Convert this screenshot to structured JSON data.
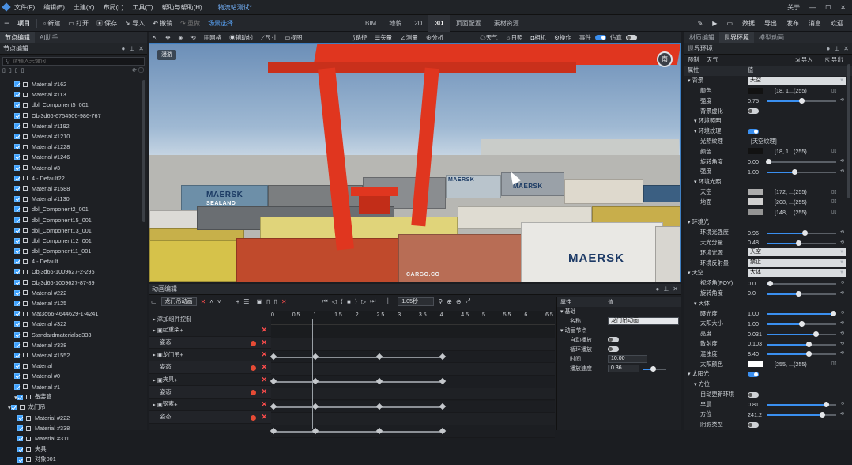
{
  "titlebar": {
    "menu": [
      "文件(F)",
      "编辑(E)",
      "土建(Y)",
      "布局(L)",
      "工具(T)",
      "帮助与帮助(H)"
    ],
    "doc_title": "物流站测试*",
    "right": [
      "关于"
    ]
  },
  "toolbar": {
    "project": "项目",
    "items": [
      "新建",
      "打开",
      "保存",
      "导入",
      "撤销",
      "重做",
      "场景选择"
    ],
    "mid_tabs": [
      "BIM",
      "地貌",
      "2D",
      "3D",
      "页面配置",
      "素材资源"
    ],
    "active_tab": "3D",
    "right_items": [
      "数据",
      "导出",
      "发布",
      "消息",
      "欢迎"
    ]
  },
  "left": {
    "tabs": [
      "节点编辑",
      "AI助手"
    ],
    "section": "节点编辑",
    "search_placeholder": "请输入关键词",
    "tree": [
      "Material #162",
      "Material #113",
      "dbl_Component5_001",
      "Obj3d66-6754506-986-767",
      "Material #1192",
      "Material #1210",
      "Material #1228",
      "Material #1246",
      "Material #3",
      "4 - Default22",
      "Material #1588",
      "Material #1130",
      "dbl_Component2_001",
      "dbl_Component15_001",
      "dbl_Component13_001",
      "dbl_Component12_001",
      "dbl_Component11_001",
      "4 - Default",
      "Obj3d66-1009627-2-295",
      "Obj3d66-1009627-87-89",
      "Material #222",
      "Material #125",
      "Mat3d66-4644629-1-4241",
      "Material #322",
      "Standardmaterialsd333",
      "Material #338",
      "Material #1552",
      "Material",
      "Material #0",
      "Material #1",
      "备装管",
      "龙门吊",
      "Material #222",
      "Material #338",
      "Material #311",
      "夹具",
      "对象001"
    ]
  },
  "viewport": {
    "toolbar": [
      "网格",
      "辅助线",
      "尺寸",
      "视图",
      "路径",
      "矢量",
      "测量",
      "分析",
      "天气",
      "日照",
      "相机",
      "操作",
      "事件",
      "仿真"
    ],
    "mode_button": "漫游",
    "compass": "南",
    "labels": {
      "maersk": "MAERSK",
      "sealand": "SEALAND",
      "cargo": "CARGO.CO"
    }
  },
  "animation": {
    "title": "动画编辑",
    "selected": "龙门吊动画",
    "time": "1.05秒",
    "add_label": "添加组件控制",
    "tracks": [
      {
        "name": "起重架",
        "sub": "姿态"
      },
      {
        "name": "龙门吊",
        "sub": "姿态"
      },
      {
        "name": "夹具",
        "sub": "姿态"
      },
      {
        "name": "钢索",
        "sub": "姿态"
      }
    ],
    "ruler": [
      "0",
      "0.5",
      "1",
      "1.5",
      "2",
      "2.5",
      "3",
      "3.5",
      "4",
      "4.5",
      "5",
      "5.5",
      "6",
      "6.5"
    ],
    "props": {
      "header_a": "属性",
      "header_b": "值",
      "basic": "基础",
      "name_label": "名称",
      "name_value": "龙门吊动画",
      "anim_node": "动画节点",
      "autoplay": "自动播放",
      "loop": "循环播放",
      "time_label": "时间",
      "time_value": "10.00",
      "speed_label": "播放速度",
      "speed_value": "0.36"
    }
  },
  "right": {
    "tabs": [
      "材质编辑",
      "世界环境",
      "模型动画"
    ],
    "active_tab": "世界环境",
    "section": "世界环境",
    "preset": "预制",
    "preset_value": "天气",
    "import": "导入",
    "export": "导出",
    "col_a": "属性",
    "col_b": "值",
    "rows": [
      {
        "label": "背景",
        "type": "select",
        "value": "天空",
        "level": 0
      },
      {
        "label": "颜色",
        "type": "color",
        "value": "[18, 1...(255)",
        "level": 2,
        "color": "#121212"
      },
      {
        "label": "强度",
        "type": "slider",
        "value": "0.75",
        "level": 2,
        "fill": 0.5
      },
      {
        "label": "背景虚化",
        "type": "toggle",
        "on": false,
        "level": 2
      },
      {
        "label": "环境照明",
        "type": "group",
        "level": 1
      },
      {
        "label": "环境纹理",
        "type": "toggle",
        "on": true,
        "level": 1
      },
      {
        "label": "光照纹理",
        "type": "text",
        "value": "[天空纹理]",
        "level": 2
      },
      {
        "label": "颜色",
        "type": "color",
        "value": "[18, 1...(255)",
        "level": 2,
        "color": "#121212"
      },
      {
        "label": "旋转角度",
        "type": "slider",
        "value": "0.00",
        "level": 2,
        "fill": 0.02
      },
      {
        "label": "强度",
        "type": "slider",
        "value": "1.00",
        "level": 2,
        "fill": 0.4
      },
      {
        "label": "环境光照",
        "type": "group",
        "level": 1
      },
      {
        "label": "天空",
        "type": "color",
        "value": "[172, ...(255)",
        "level": 2,
        "color": "#acacac"
      },
      {
        "label": "地面",
        "type": "color",
        "value": "[208, ...(255)",
        "level": 2,
        "color": "#d0d0d0"
      },
      {
        "label": "",
        "type": "color",
        "value": "[148, ...(255)",
        "level": 2,
        "color": "#949494"
      },
      {
        "label": "环境光",
        "type": "group",
        "level": 0
      },
      {
        "label": "环境光强度",
        "type": "slider",
        "value": "0.96",
        "level": 2,
        "fill": 0.55
      },
      {
        "label": "天光分量",
        "type": "slider",
        "value": "0.48",
        "level": 2,
        "fill": 0.45
      },
      {
        "label": "环境光源",
        "type": "select",
        "value": "天空",
        "level": 2
      },
      {
        "label": "环境反射量",
        "type": "select",
        "value": "禁止",
        "level": 2
      },
      {
        "label": "天空",
        "type": "select",
        "value": "大体",
        "level": 0
      },
      {
        "label": "视场角(FOV)",
        "type": "slider",
        "value": "0.0",
        "level": 2,
        "fill": 0.05
      },
      {
        "label": "旋转角度",
        "type": "slider",
        "value": "0.0",
        "level": 2,
        "fill": 0.45
      },
      {
        "label": "天体",
        "type": "group",
        "level": 1
      },
      {
        "label": "曝光度",
        "type": "slider",
        "value": "1.00",
        "level": 2,
        "fill": 0.95
      },
      {
        "label": "太阳大小",
        "type": "slider",
        "value": "1.00",
        "level": 2,
        "fill": 0.5
      },
      {
        "label": "亮度",
        "type": "slider",
        "value": "0.031",
        "level": 2,
        "fill": 0.7
      },
      {
        "label": "散射度",
        "type": "slider",
        "value": "0.103",
        "level": 2,
        "fill": 0.6
      },
      {
        "label": "混浊度",
        "type": "slider",
        "value": "8.40",
        "level": 2,
        "fill": 0.6
      },
      {
        "label": "太阳颜色",
        "type": "color",
        "value": "[255, ...(255)",
        "level": 2,
        "color": "#ffffff"
      },
      {
        "label": "太阳光",
        "type": "toggle",
        "on": true,
        "level": 0
      },
      {
        "label": "方位",
        "type": "group",
        "level": 1
      },
      {
        "label": "自动更新环境",
        "type": "toggle",
        "on": false,
        "level": 2
      },
      {
        "label": "早晨",
        "type": "slider",
        "value": "0.81",
        "level": 2,
        "fill": 0.85
      },
      {
        "label": "方位",
        "type": "slider",
        "value": "241.2",
        "level": 2,
        "fill": 0.8
      },
      {
        "label": "阴影类型",
        "type": "toggle",
        "on": false,
        "level": 2
      }
    ]
  }
}
